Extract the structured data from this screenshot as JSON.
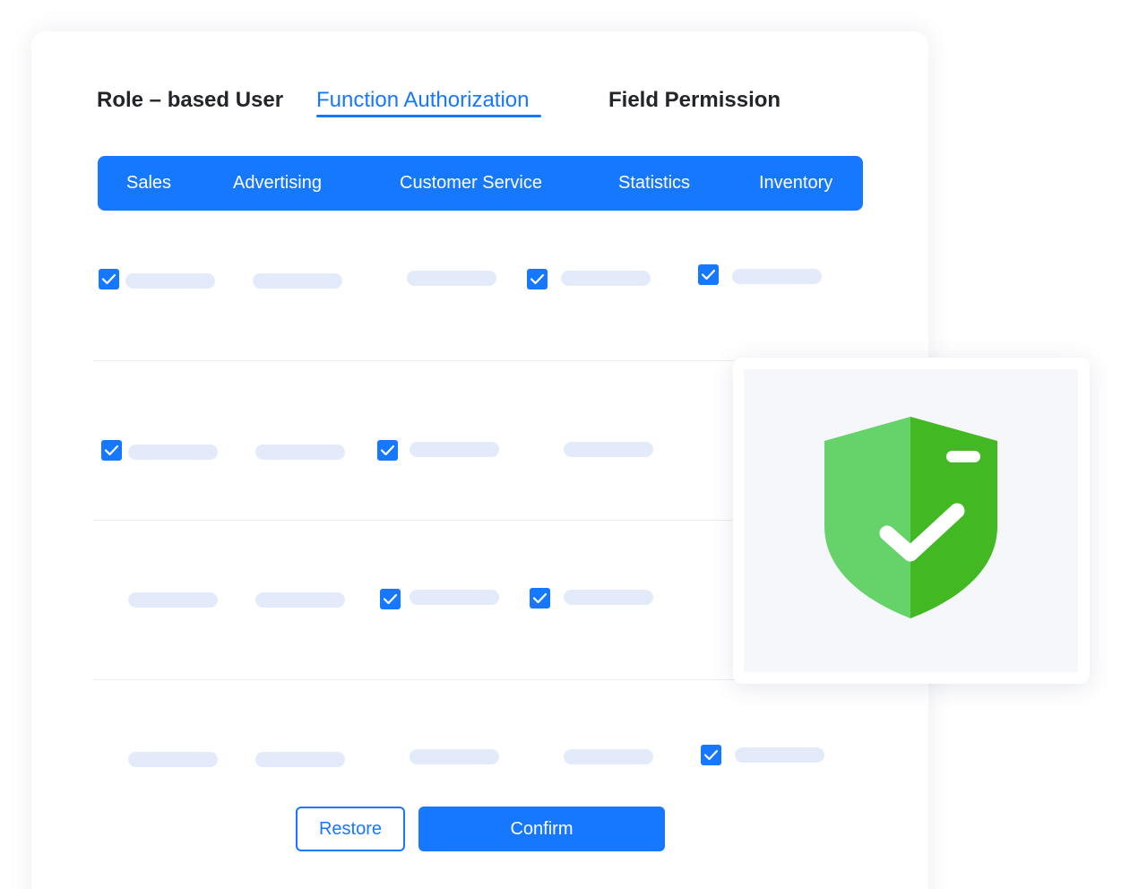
{
  "tabs": {
    "role_based_user": "Role – based User",
    "function_authorization": "Function Authorization",
    "field_permission": "Field Permission",
    "active": "function_authorization"
  },
  "modules": [
    "Sales",
    "Advertising",
    "Customer Service",
    "Statistics",
    "Inventory"
  ],
  "permission_rows": [
    {
      "checked": [
        true,
        false,
        false,
        true,
        true
      ]
    },
    {
      "checked": [
        true,
        false,
        true,
        false
      ]
    },
    {
      "checked": [
        false,
        false,
        true,
        true
      ]
    },
    {
      "checked": [
        false,
        false,
        false,
        false,
        true
      ]
    }
  ],
  "actions": {
    "restore_label": "Restore",
    "confirm_label": "Confirm"
  },
  "colors": {
    "accent": "#1677ff",
    "placeholder": "#e3ebfb",
    "shield_light": "#66d36a",
    "shield_dark": "#42b822"
  },
  "badge": {
    "icon": "shield-check-icon"
  }
}
